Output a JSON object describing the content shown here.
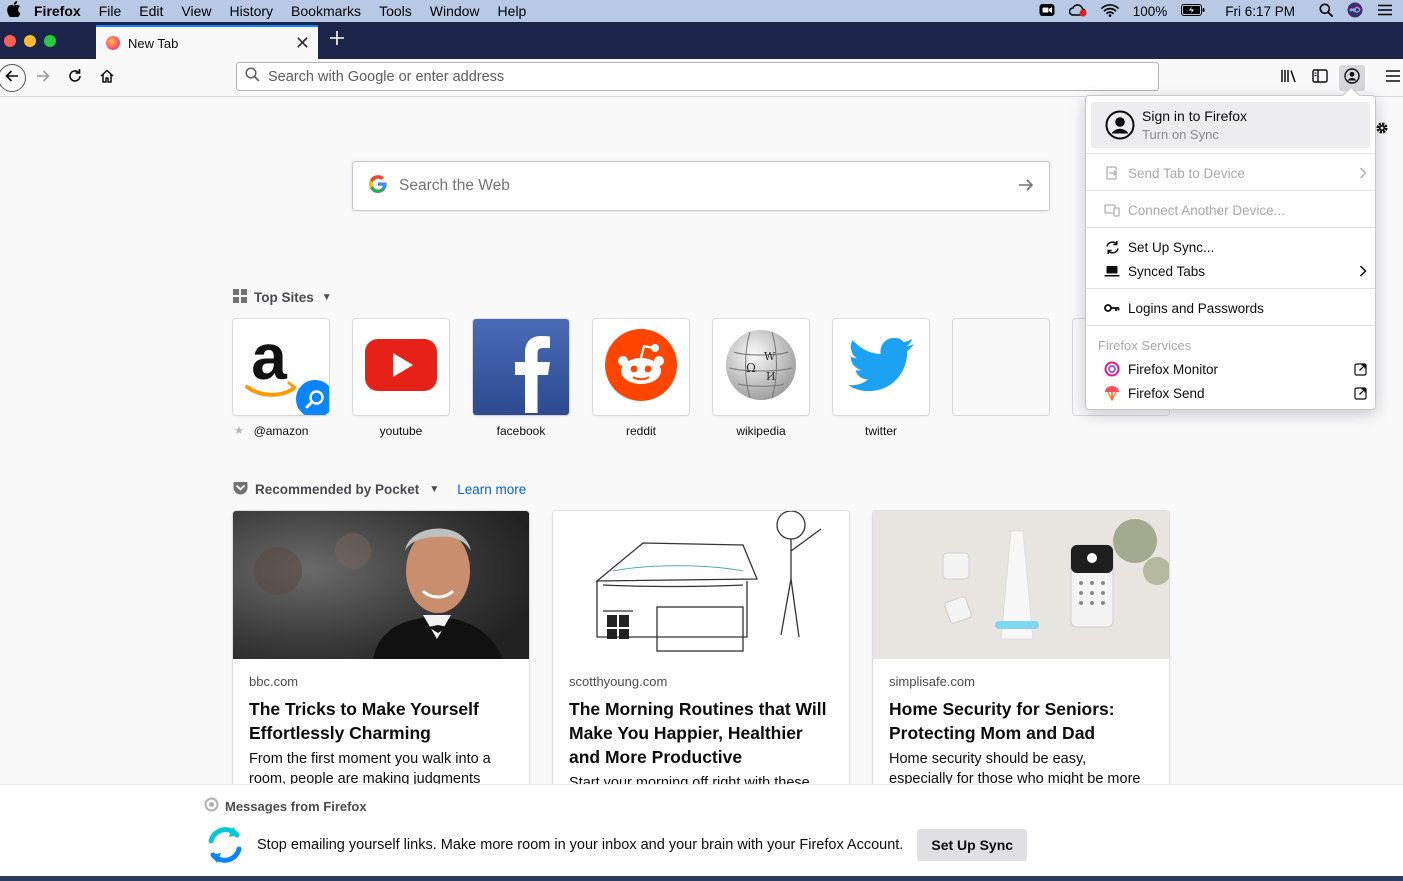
{
  "menubar": {
    "app_name": "Firefox",
    "items": [
      "File",
      "Edit",
      "View",
      "History",
      "Bookmarks",
      "Tools",
      "Window",
      "Help"
    ],
    "battery": "100%",
    "clock": "Fri 6:17 PM"
  },
  "tab": {
    "title": "New Tab"
  },
  "urlbar": {
    "placeholder": "Search with Google or enter address"
  },
  "search": {
    "placeholder": "Search the Web"
  },
  "top_sites": {
    "heading": "Top Sites",
    "sites": [
      {
        "label": "@amazon"
      },
      {
        "label": "youtube"
      },
      {
        "label": "facebook"
      },
      {
        "label": "reddit"
      },
      {
        "label": "wikipedia"
      },
      {
        "label": "twitter"
      }
    ]
  },
  "pocket": {
    "heading": "Recommended by Pocket",
    "learn_more": "Learn more",
    "cards": [
      {
        "source": "bbc.com",
        "title": "The Tricks to Make Yourself Effortlessly Charming",
        "excerpt": "From the first moment you walk into a room, people are making judgments"
      },
      {
        "source": "scotthyoung.com",
        "title": "The Morning Routines that Will Make You Happier, Healthier and More Productive",
        "excerpt": "Start your morning off right with these"
      },
      {
        "source": "simplisafe.com",
        "title": "Home Security for Seniors: Protecting Mom and Dad",
        "excerpt": "Home security should be easy, especially for those who might be more"
      }
    ]
  },
  "messages": {
    "heading": "Messages from Firefox",
    "body": "Stop emailing yourself links. Make more room in your inbox and your brain with your Firefox Account.",
    "cta": "Set Up Sync"
  },
  "account_panel": {
    "sign_in": "Sign in to Firefox",
    "sign_in_sub": "Turn on Sync",
    "send_tab": "Send Tab to Device",
    "connect_device": "Connect Another Device...",
    "setup_sync": "Set Up Sync...",
    "synced_tabs": "Synced Tabs",
    "logins": "Logins and Passwords",
    "services_header": "Firefox Services",
    "monitor": "Firefox Monitor",
    "send": "Firefox Send"
  },
  "colors": {
    "menubar": "#b8c9e6",
    "tabstrip": "#1d2449",
    "accent": "#0a84ff",
    "link": "#0060df"
  }
}
